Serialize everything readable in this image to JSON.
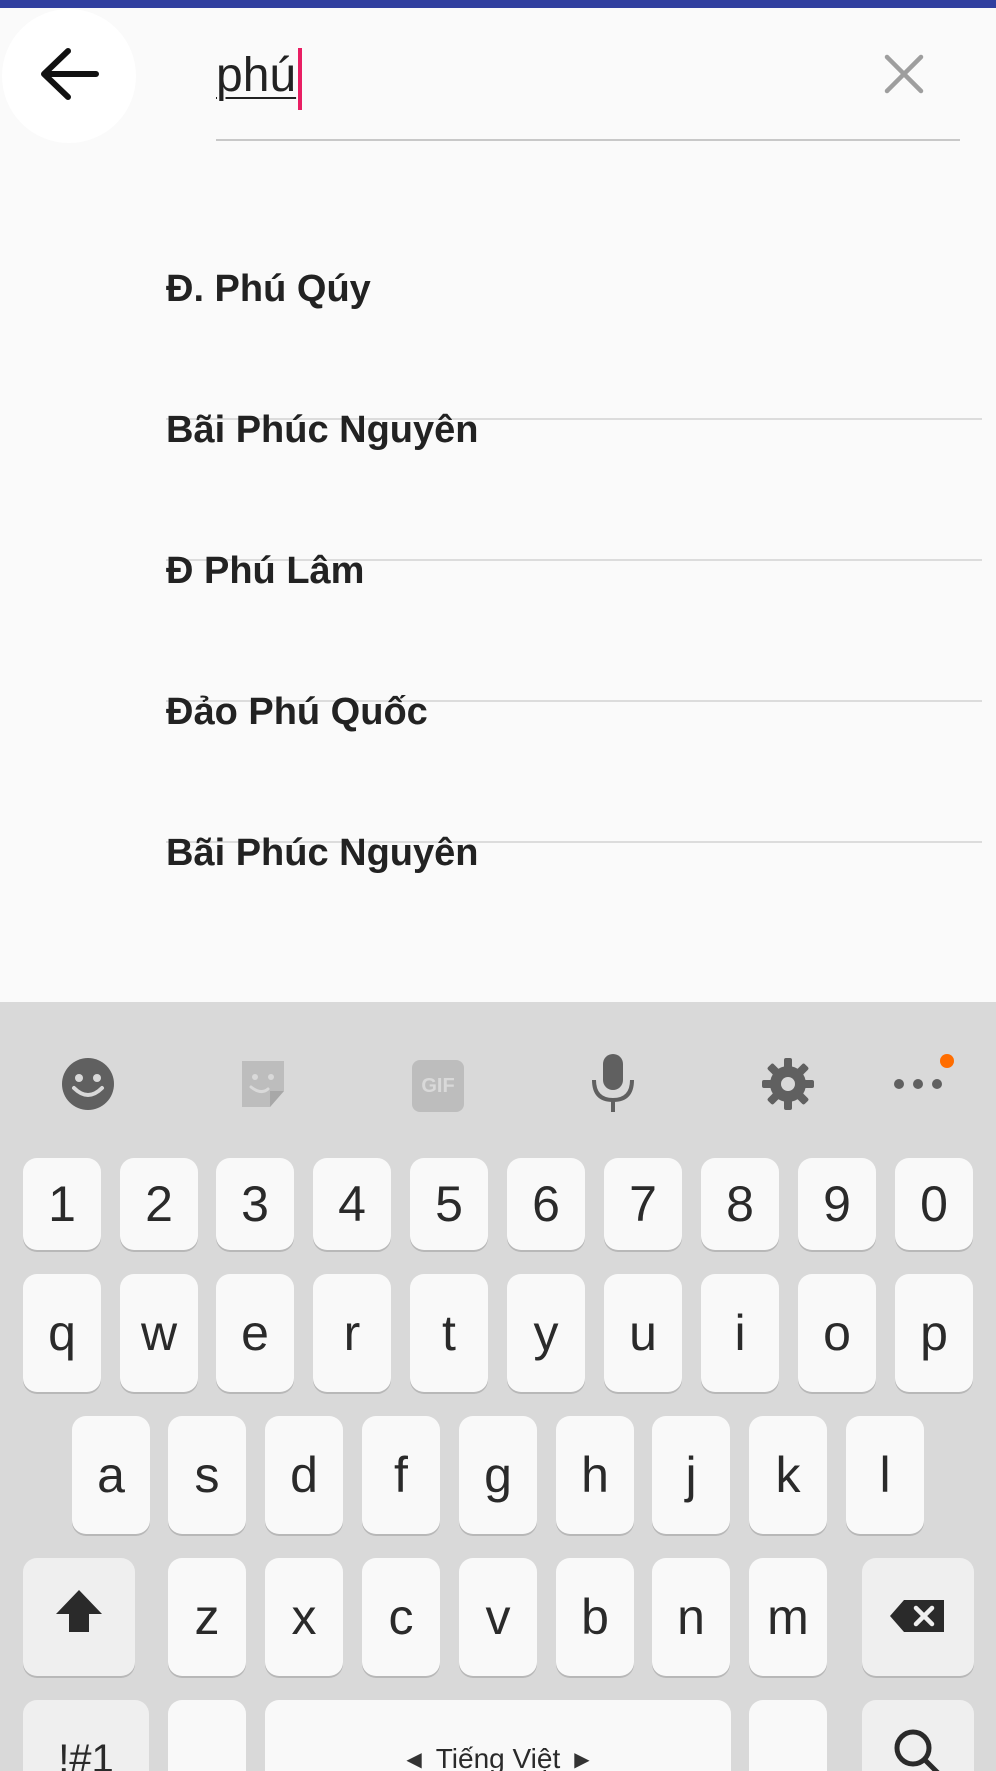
{
  "search": {
    "query": "phú",
    "back_icon": "arrow-left-icon",
    "clear_icon": "close-icon"
  },
  "results": [
    {
      "label": "Đ. Phú Qúy"
    },
    {
      "label": "Bãi Phúc Nguyên"
    },
    {
      "label": "Đ Phú Lâm"
    },
    {
      "label": "Đảo Phú Quốc"
    },
    {
      "label": "Bãi Phúc Nguyên"
    }
  ],
  "keyboard": {
    "toolbar": [
      "emoji-icon",
      "sticker-icon",
      "gif-icon",
      "microphone-icon",
      "settings-icon",
      "more-icon"
    ],
    "gif_label": "GIF",
    "number_row": [
      "1",
      "2",
      "3",
      "4",
      "5",
      "6",
      "7",
      "8",
      "9",
      "0"
    ],
    "row1": [
      "q",
      "w",
      "e",
      "r",
      "t",
      "y",
      "u",
      "i",
      "o",
      "p"
    ],
    "row2": [
      "a",
      "s",
      "d",
      "f",
      "g",
      "h",
      "j",
      "k",
      "l"
    ],
    "row3": [
      "z",
      "x",
      "c",
      "v",
      "b",
      "n",
      "m"
    ],
    "symbols_label": "!#1",
    "space_label": "Tiếng Việt",
    "colors": {
      "accent_dot": "#ff6d00",
      "caret": "#e91e63",
      "status_bar": "#303f9f"
    }
  }
}
